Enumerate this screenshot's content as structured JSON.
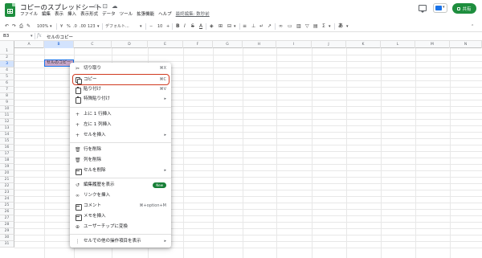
{
  "header": {
    "title": "コピーのスプレッドシート",
    "menu": [
      "ファイル",
      "編集",
      "表示",
      "挿入",
      "表示形式",
      "データ",
      "ツール",
      "拡張機能",
      "ヘルプ"
    ],
    "last_edit": "最終編集: 数秒前",
    "share_label": "共有"
  },
  "toolbar": {
    "zoom": "100%",
    "currency": "¥",
    "percent": "%",
    "dec_less": ".0",
    "dec_more": ".00",
    "format_123": "123",
    "font": "デフォルト...",
    "font_size": "10",
    "bold": "B",
    "italic": "I",
    "strike": "S",
    "text_color": "A",
    "sigma": "Σ",
    "more": "あ"
  },
  "formula_bar": {
    "cell_ref": "B3",
    "fx": "fx",
    "value": "セルのコピー"
  },
  "grid": {
    "columns": [
      "A",
      "B",
      "C",
      "D",
      "E",
      "F",
      "G",
      "H",
      "I",
      "J",
      "K",
      "L",
      "M",
      "N"
    ],
    "rows": [
      "1",
      "2",
      "3",
      "4",
      "5",
      "6",
      "7",
      "8",
      "9",
      "10",
      "11",
      "12",
      "13",
      "14",
      "15",
      "16",
      "17",
      "18",
      "19",
      "20",
      "21",
      "22",
      "23",
      "24",
      "25",
      "26",
      "27",
      "28",
      "29",
      "30",
      "31"
    ],
    "active_cell_text": "セルのコピー",
    "active_cell_color": "#c9a7c9"
  },
  "context_menu": {
    "items": [
      {
        "label": "切り取り",
        "shortcut": "⌘X",
        "icon": "scissors-icon"
      },
      {
        "label": "コピー",
        "shortcut": "⌘C",
        "icon": "copy-icon"
      },
      {
        "label": "貼り付け",
        "shortcut": "⌘V",
        "icon": "paste-icon"
      },
      {
        "label": "特殊貼り付け",
        "arrow": "▸",
        "icon": "paste-special-icon"
      },
      {
        "label": "上に 1 行挿入",
        "icon": "plus-icon"
      },
      {
        "label": "左に 1 列挿入",
        "icon": "plus-icon"
      },
      {
        "label": "セルを挿入",
        "arrow": "▸",
        "icon": "plus-icon"
      },
      {
        "label": "行を削除",
        "icon": "trash-icon"
      },
      {
        "label": "列を削除",
        "icon": "trash-icon"
      },
      {
        "label": "セルを削除",
        "arrow": "▸",
        "icon": "delete-cells-icon"
      },
      {
        "label": "編集履歴を表示",
        "badge": "New",
        "icon": "history-icon"
      },
      {
        "label": "リンクを挿入",
        "icon": "link-icon"
      },
      {
        "label": "コメント",
        "shortcut": "⌘+option+M",
        "icon": "comment-icon"
      },
      {
        "label": "メモを挿入",
        "icon": "note-icon"
      },
      {
        "label": "ユーザーチップに変換",
        "icon": "people-chip-icon"
      },
      {
        "label": "セルでの他の操作項目を表示",
        "arrow": "▸",
        "icon": "more-vert-icon"
      }
    ]
  },
  "colors": {
    "accent": "#1a73e8",
    "share": "#1e8e3e",
    "highlight_border": "#d0391f"
  }
}
